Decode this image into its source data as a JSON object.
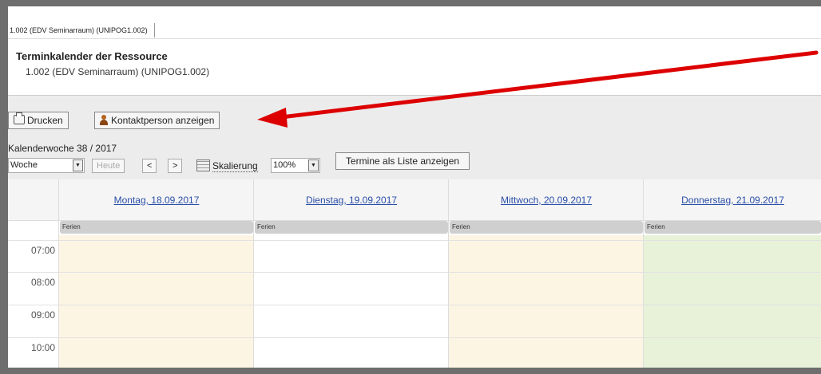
{
  "tab": {
    "label": "1.002 (EDV Seminarraum) (UNIPOG1.002)"
  },
  "header": {
    "title": "Terminkalender der Ressource",
    "subtitle": "1.002 (EDV Seminarraum) (UNIPOG1.002)"
  },
  "toolbar": {
    "print_label": "Drucken",
    "contact_label": "Kontaktperson anzeigen",
    "calendar_week": "Kalenderwoche 38 / 2017",
    "view_select": "Woche",
    "today_label": "Heute",
    "prev_label": "<",
    "next_label": ">",
    "scale_label": "Skalierung",
    "scale_select": "100%",
    "list_label": "Termine als Liste anzeigen"
  },
  "calendar": {
    "days": [
      {
        "label": "Montag, 18.09.2017",
        "event": "Ferien",
        "bg": "#fdf5e4"
      },
      {
        "label": "Dienstag, 19.09.2017",
        "event": "Ferien",
        "bg": "#ffffff"
      },
      {
        "label": "Mittwoch, 20.09.2017",
        "event": "Ferien",
        "bg": "#fdf5e4"
      },
      {
        "label": "Donnerstag, 21.09.2017",
        "event": "Ferien",
        "bg": "#e8f2d8"
      }
    ],
    "times": [
      "07:00",
      "08:00",
      "09:00",
      "10:00"
    ]
  },
  "colors": {
    "annotation_arrow": "#dd0000",
    "link": "#2a4ea8"
  }
}
